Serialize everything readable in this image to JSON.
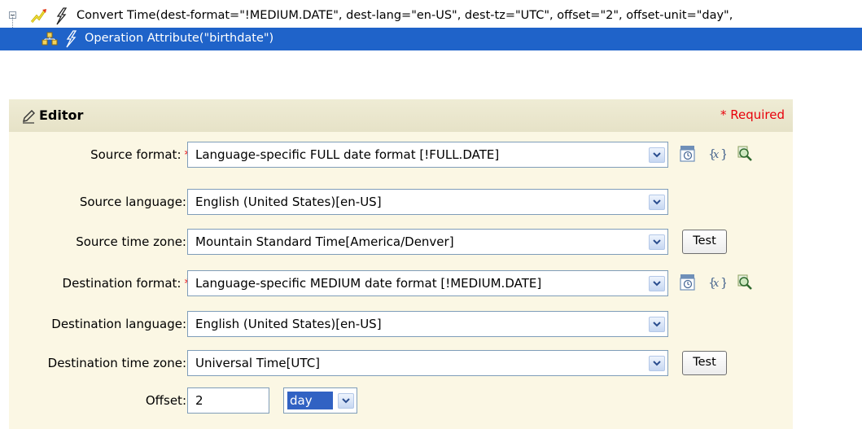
{
  "tree": {
    "rule_text": "Convert Time(dest-format=\"!MEDIUM.DATE\", dest-lang=\"en-US\", dest-tz=\"UTC\", offset=\"2\", offset-unit=\"day\",",
    "child_text": "Operation Attribute(\"birthdate\")",
    "selected_bg": "#1f63c9"
  },
  "editor": {
    "title": "Editor",
    "required_note": "* Required",
    "required_color": "#e8000b",
    "fields": {
      "source_format": {
        "label": "Source format:",
        "value": "Language-specific FULL date format [!FULL.DATE]"
      },
      "source_language": {
        "label": "Source language:",
        "value": "English (United States)[en-US]"
      },
      "source_tz": {
        "label": "Source time zone:",
        "value": "Mountain Standard Time[America/Denver]"
      },
      "dest_format": {
        "label": "Destination format:",
        "value": "Language-specific MEDIUM date format [!MEDIUM.DATE]"
      },
      "dest_language": {
        "label": "Destination language:",
        "value": "English (United States)[en-US]"
      },
      "dest_tz": {
        "label": "Destination time zone:",
        "value": "Universal Time[UTC]"
      },
      "offset": {
        "label": "Offset:",
        "value": "2",
        "unit": "day"
      }
    },
    "test_label": "Test",
    "star": "*"
  }
}
